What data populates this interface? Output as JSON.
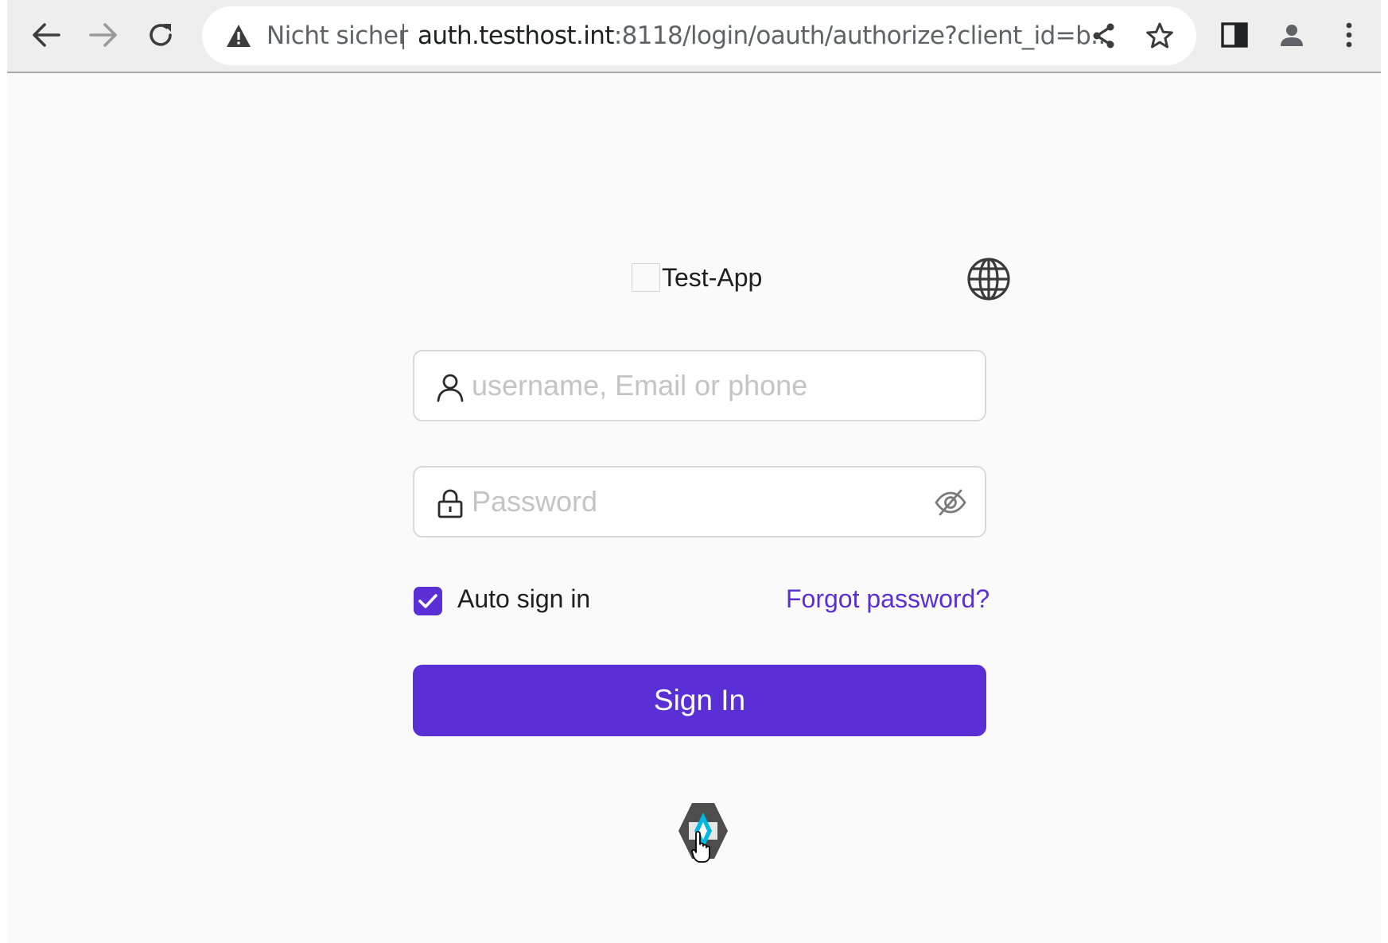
{
  "browser": {
    "nav": {
      "back_icon": "arrow-left-icon",
      "forward_icon": "arrow-right-icon",
      "reload_icon": "reload-icon"
    },
    "omnibox": {
      "security_icon": "warning-triangle-icon",
      "security_text": "Nicht sicher",
      "url_host": "auth.testhost.int",
      "url_rest": ":8118/login/oauth/authorize?client_id=b..."
    },
    "actions": {
      "share_icon": "share-icon",
      "bookmark_icon": "star-icon",
      "sidepanel_icon": "side-panel-icon",
      "profile_icon": "profile-icon",
      "menu_icon": "kebab-menu-icon"
    }
  },
  "login": {
    "app_name": "Test-App",
    "language_icon": "globe-icon",
    "username": {
      "placeholder": "username, Email or phone",
      "value": "",
      "icon": "user-icon"
    },
    "password": {
      "placeholder": "Password",
      "value": "",
      "icon": "lock-icon",
      "toggle_icon": "eye-off-icon"
    },
    "auto_sign_in": {
      "label": "Auto sign in",
      "checked": true
    },
    "forgot_password": "Forgot password?",
    "sign_in_button": "Sign In",
    "provider_icon": "keycloak-icon"
  },
  "colors": {
    "accent": "#5a2fd6",
    "page_bg": "#fafafa",
    "toolbar_bg": "#eeeeee"
  }
}
